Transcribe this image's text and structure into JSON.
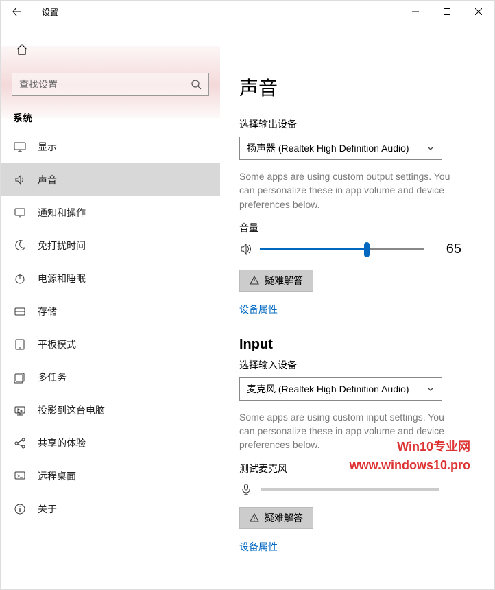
{
  "titlebar": {
    "title": "设置"
  },
  "sidebar": {
    "search_placeholder": "查找设置",
    "category": "系统",
    "items": [
      {
        "icon": "display",
        "label": "显示"
      },
      {
        "icon": "sound",
        "label": "声音"
      },
      {
        "icon": "notify",
        "label": "通知和操作"
      },
      {
        "icon": "moon",
        "label": "免打扰时间"
      },
      {
        "icon": "power",
        "label": "电源和睡眠"
      },
      {
        "icon": "storage",
        "label": "存储"
      },
      {
        "icon": "tablet",
        "label": "平板模式"
      },
      {
        "icon": "multitask",
        "label": "多任务"
      },
      {
        "icon": "project",
        "label": "投影到这台电脑"
      },
      {
        "icon": "share",
        "label": "共享的体验"
      },
      {
        "icon": "remote",
        "label": "远程桌面"
      },
      {
        "icon": "about",
        "label": "关于"
      }
    ],
    "selected_index": 1
  },
  "content": {
    "page_title": "声音",
    "output": {
      "device_label": "选择输出设备",
      "device_value": "扬声器 (Realtek High Definition Audio)",
      "hint": "Some apps are using custom output settings. You can personalize these in app volume and device preferences below.",
      "volume_label": "音量",
      "volume_value": 65,
      "troubleshoot": "疑难解答",
      "props_link": "设备属性"
    },
    "input": {
      "heading": "Input",
      "device_label": "选择输入设备",
      "device_value": "麦克风 (Realtek High Definition Audio)",
      "hint": "Some apps are using custom input settings. You can personalize these in app volume and device preferences below.",
      "test_label": "测试麦克风",
      "troubleshoot": "疑难解答",
      "props_link": "设备属性"
    }
  },
  "watermark": {
    "line1": "Win10专业网",
    "line2": "www.windows10.pro"
  }
}
